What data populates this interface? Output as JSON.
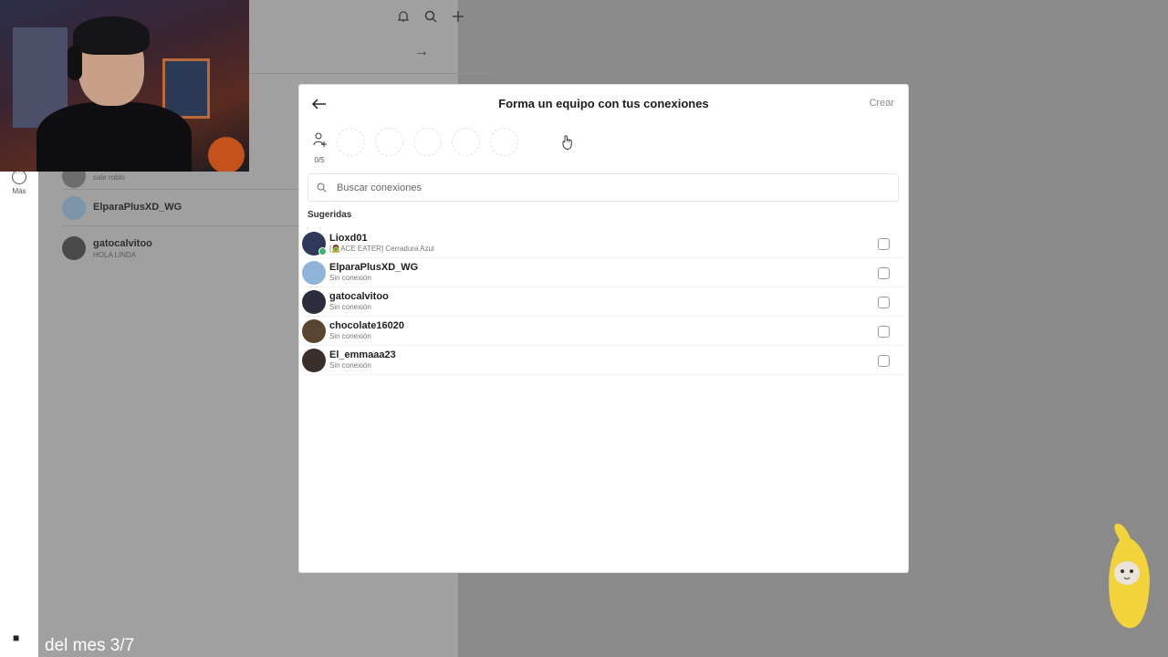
{
  "background_app": {
    "rail": {
      "more_label": "Más"
    },
    "chats": [
      {
        "name": "",
        "sub": "sale roblo"
      },
      {
        "name": "ElparaPlusXD_WG",
        "sub": ""
      },
      {
        "name": "gatocalvitoo",
        "sub": "HOLA LINDA"
      }
    ]
  },
  "overlay": {
    "stream_text": "del mes 3/7"
  },
  "modal": {
    "title": "Forma un equipo con tus conexiones",
    "create_label": "Crear",
    "slot_count": "0/5",
    "slots_total": 5,
    "search_placeholder": "Buscar conexiones",
    "section_label": "Sugeridas",
    "connections": [
      {
        "name": "Lioxd01",
        "status": "[🧟ACE EATER] Cerradura Azul",
        "online": true,
        "avatar_color": "#2f3a5a"
      },
      {
        "name": "ElparaPlusXD_WG",
        "status": "Sin conexión",
        "online": false,
        "avatar_color": "#8fb4d8"
      },
      {
        "name": "gatocalvitoo",
        "status": "Sin conexión",
        "online": false,
        "avatar_color": "#2b2d3e"
      },
      {
        "name": "chocolate16020",
        "status": "Sin conexión",
        "online": false,
        "avatar_color": "#5a4630"
      },
      {
        "name": "El_emmaaa23",
        "status": "Sin conexión",
        "online": false,
        "avatar_color": "#3a2e2a"
      }
    ]
  },
  "colors": {
    "overlay_dim": "#8a8a8a",
    "online": "#3bb273",
    "modal_bg": "#ffffff"
  }
}
